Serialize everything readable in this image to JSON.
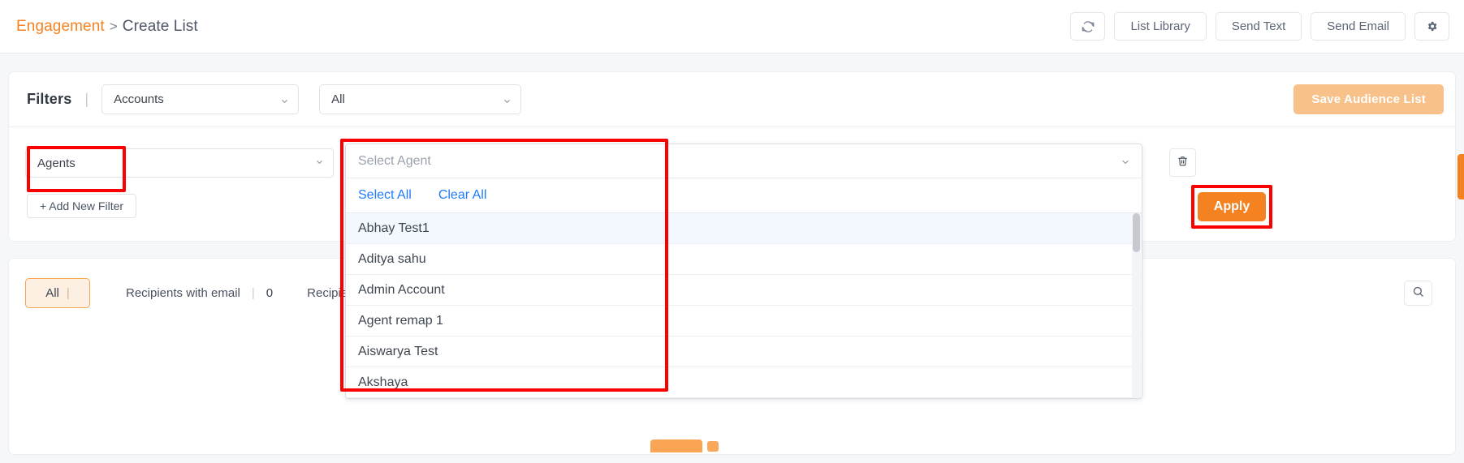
{
  "breadcrumb": {
    "root": "Engagement",
    "separator": ">",
    "leaf": "Create List"
  },
  "toolbar": {
    "refresh_icon": "refresh-icon",
    "list_library": "List Library",
    "send_text": "Send Text",
    "send_email": "Send Email",
    "settings_icon": "gear-icon"
  },
  "filters": {
    "label": "Filters",
    "divider": "|",
    "account_select": "Accounts",
    "scope_select": "All",
    "save_button": "Save Audience List",
    "agents_select": "Agents",
    "add_new_filter": "+ Add New Filter",
    "apply_button": "Apply",
    "delete_icon": "trash-icon"
  },
  "agent_dropdown": {
    "placeholder": "Select Agent",
    "select_all": "Select All",
    "clear_all": "Clear All",
    "items": [
      {
        "label": "Abhay Test1",
        "highlighted": true
      },
      {
        "label": "Aditya sahu",
        "highlighted": false
      },
      {
        "label": "Admin Account",
        "highlighted": false
      },
      {
        "label": "Agent remap 1",
        "highlighted": false
      },
      {
        "label": "Aiswarya Test",
        "highlighted": false
      },
      {
        "label": "Akshaya",
        "highlighted": false
      }
    ]
  },
  "results": {
    "tab_all": "All",
    "tab_divider": "|",
    "recipients_email_label": "Recipients with email",
    "recipients_email_divider": "|",
    "recipients_email_count": "0",
    "recipients_partial_label": "Recipien",
    "search_icon": "search-icon"
  },
  "colors": {
    "accent_orange": "#f58220",
    "accent_orange_muted": "#f8c18a",
    "link_blue": "#1f7bfb",
    "annotation_red": "#fb0000",
    "highlight_row": "#f2f8fe"
  }
}
